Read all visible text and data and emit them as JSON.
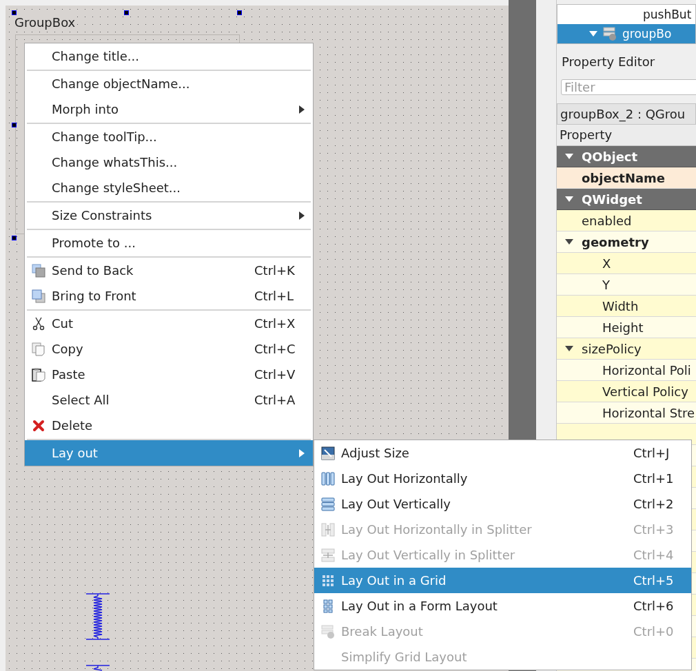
{
  "canvas": {
    "group_box": {
      "title": "GroupBox"
    }
  },
  "object_inspector": {
    "rows": [
      {
        "label": "pushBut",
        "selected": false,
        "expanded": false
      },
      {
        "label": "groupBo",
        "selected": true,
        "expanded": true
      }
    ]
  },
  "property_editor": {
    "title": "Property Editor",
    "filter": {
      "placeholder": "Filter"
    },
    "object_label": "groupBox_2 : QGrou",
    "header": "Property",
    "categories": [
      {
        "label": "QObject",
        "expanded": true,
        "color": "#fdebd7",
        "children": [
          {
            "label": "objectName",
            "modified": true
          }
        ]
      },
      {
        "label": "QWidget",
        "expanded": true,
        "color": "#fffbd0",
        "children": [
          {
            "label": "enabled",
            "modified": false
          },
          {
            "label": "geometry",
            "modified": true,
            "expanded": true,
            "children": [
              {
                "label": "X"
              },
              {
                "label": "Y"
              },
              {
                "label": "Width"
              },
              {
                "label": "Height"
              }
            ]
          },
          {
            "label": "sizePolicy",
            "modified": false,
            "expanded": true,
            "children": [
              {
                "label": "Horizontal Poli"
              },
              {
                "label": "Vertical Policy"
              },
              {
                "label": "Horizontal Stre"
              }
            ]
          }
        ]
      }
    ]
  },
  "context_menu": {
    "items": [
      {
        "kind": "action",
        "label": "Change title..."
      },
      {
        "kind": "separator"
      },
      {
        "kind": "action",
        "label": "Change objectName..."
      },
      {
        "kind": "submenu",
        "label": "Morph into",
        "selected": false
      },
      {
        "kind": "separator"
      },
      {
        "kind": "action",
        "label": "Change toolTip..."
      },
      {
        "kind": "action",
        "label": "Change whatsThis..."
      },
      {
        "kind": "action",
        "label": "Change styleSheet..."
      },
      {
        "kind": "separator"
      },
      {
        "kind": "submenu",
        "label": "Size Constraints",
        "selected": false
      },
      {
        "kind": "separator"
      },
      {
        "kind": "action",
        "label": "Promote to ..."
      },
      {
        "kind": "separator"
      },
      {
        "kind": "action",
        "label": "Send to Back",
        "shortcut": "Ctrl+K"
      },
      {
        "kind": "action",
        "label": "Bring to Front",
        "shortcut": "Ctrl+L"
      },
      {
        "kind": "separator"
      },
      {
        "kind": "action",
        "label": "Cut",
        "shortcut": "Ctrl+X"
      },
      {
        "kind": "action",
        "label": "Copy",
        "shortcut": "Ctrl+C"
      },
      {
        "kind": "action",
        "label": "Paste",
        "shortcut": "Ctrl+V"
      },
      {
        "kind": "action",
        "label": "Select All",
        "shortcut": "Ctrl+A"
      },
      {
        "kind": "action",
        "label": "Delete"
      },
      {
        "kind": "separator"
      },
      {
        "kind": "submenu",
        "label": "Lay out",
        "selected": true
      }
    ]
  },
  "layout_submenu": {
    "items": [
      {
        "label": "Adjust Size",
        "shortcut": "Ctrl+J",
        "disabled": false,
        "selected": false
      },
      {
        "label": "Lay Out Horizontally",
        "shortcut": "Ctrl+1",
        "disabled": false,
        "selected": false
      },
      {
        "label": "Lay Out Vertically",
        "shortcut": "Ctrl+2",
        "disabled": false,
        "selected": false
      },
      {
        "label": "Lay Out Horizontally in Splitter",
        "shortcut": "Ctrl+3",
        "disabled": true,
        "selected": false
      },
      {
        "label": "Lay Out Vertically in Splitter",
        "shortcut": "Ctrl+4",
        "disabled": true,
        "selected": false
      },
      {
        "label": "Lay Out in a Grid",
        "shortcut": "Ctrl+5",
        "disabled": false,
        "selected": true
      },
      {
        "label": "Lay Out in a Form Layout",
        "shortcut": "Ctrl+6",
        "disabled": false,
        "selected": false
      },
      {
        "label": "Break Layout",
        "shortcut": "Ctrl+0",
        "disabled": true,
        "selected": false
      },
      {
        "label": "Simplify Grid Layout",
        "disabled": true,
        "selected": false
      }
    ]
  }
}
